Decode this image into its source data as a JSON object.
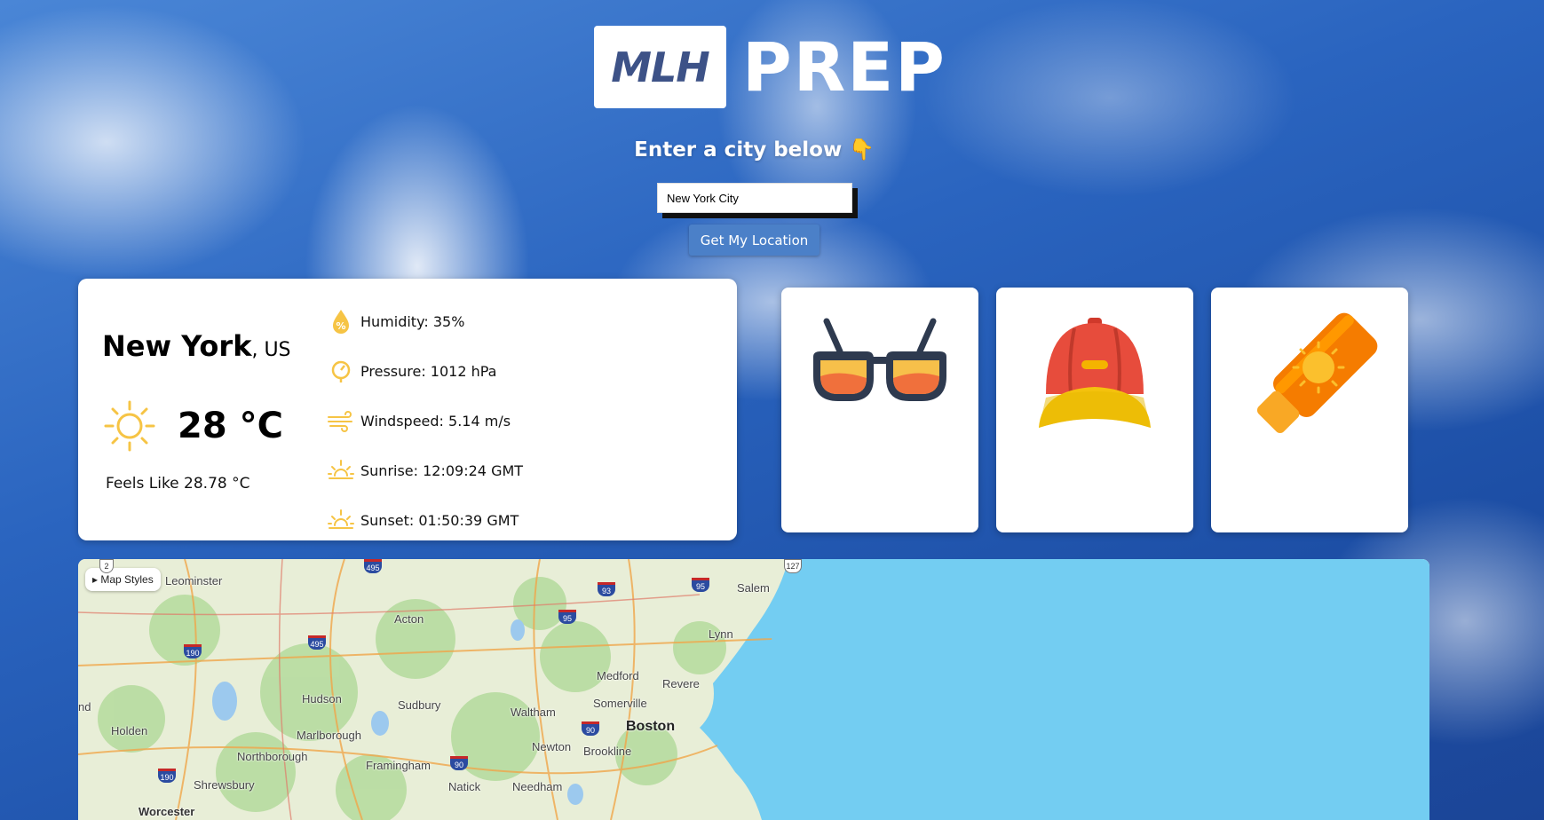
{
  "logo": {
    "badge": "MLH",
    "word": "PREP"
  },
  "prompt": {
    "text": "Enter a city below",
    "emoji": "👇"
  },
  "search": {
    "value": "New York City"
  },
  "location_button": {
    "label": "Get My Location"
  },
  "weather": {
    "city": "New York",
    "country": ", US",
    "temperature": "28 °C",
    "feels_like": "Feels Like 28.78 °C",
    "details": [
      {
        "icon": "humidity-icon",
        "text": "Humidity: 35%"
      },
      {
        "icon": "pressure-icon",
        "text": "Pressure: 1012 hPa"
      },
      {
        "icon": "wind-icon",
        "text": "Windspeed: 5.14 m/s"
      },
      {
        "icon": "sunrise-icon",
        "text": "Sunrise: 12:09:24 GMT"
      },
      {
        "icon": "sunset-icon",
        "text": "Sunset: 01:50:39 GMT"
      }
    ]
  },
  "items": [
    {
      "icon": "sunglasses-icon"
    },
    {
      "icon": "cap-icon"
    },
    {
      "icon": "sunscreen-icon"
    }
  ],
  "map": {
    "styles_button": "▸ Map Styles",
    "places": [
      "Leominster",
      "Acton",
      "Salem",
      "Lynn",
      "Medford",
      "Revere",
      "Hudson",
      "Sudbury",
      "Waltham",
      "Somerville",
      "Boston",
      "Holden",
      "Marlborough",
      "Northborough",
      "Framingham",
      "Newton",
      "Brookline",
      "Shrewsbury",
      "Natick",
      "Needham",
      "Worcester",
      "nd"
    ],
    "shields": [
      "495",
      "93",
      "95",
      "95",
      "495",
      "190",
      "90",
      "90",
      "190",
      "127",
      "2"
    ]
  },
  "colors": {
    "accent": "#4b80c8",
    "sun": "#f6c445",
    "water": "#73cdf2"
  }
}
